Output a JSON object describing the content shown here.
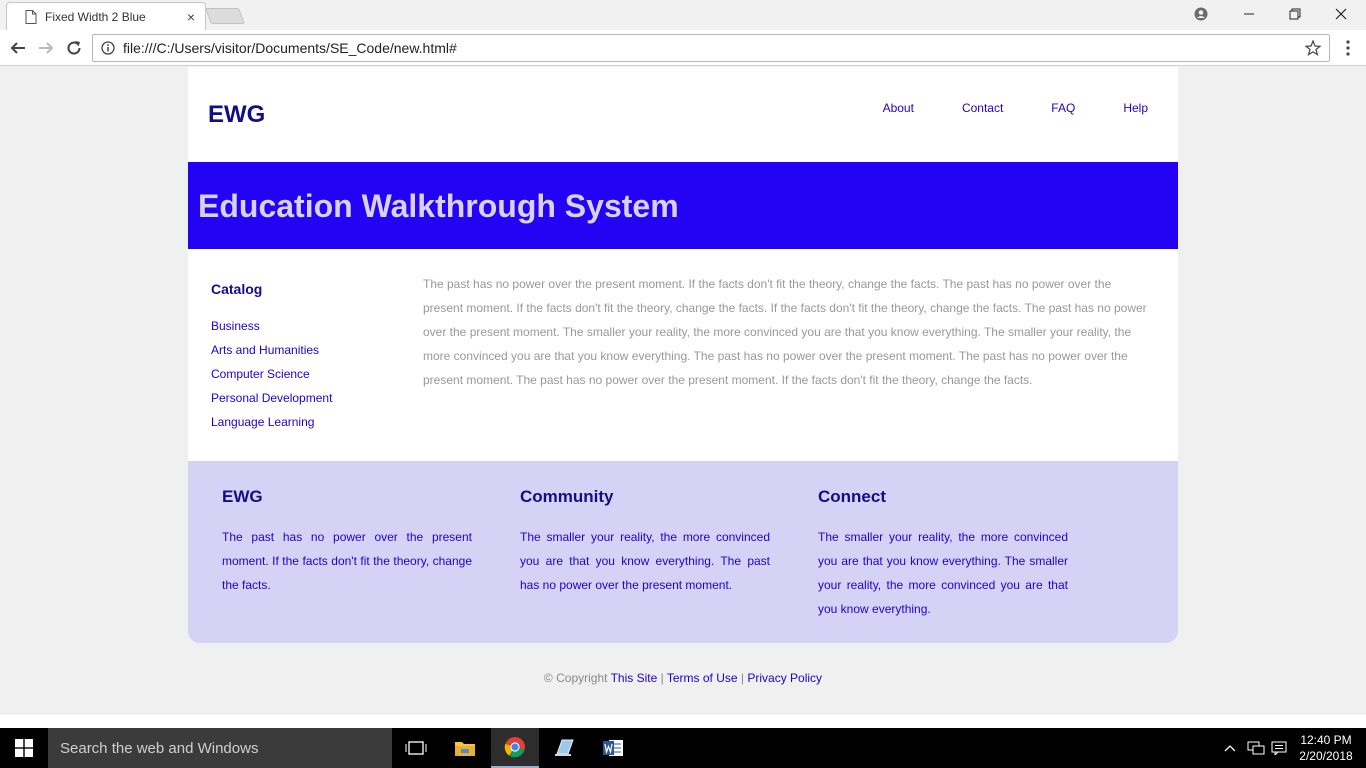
{
  "browser": {
    "tab_title": "Fixed Width 2 Blue",
    "tab_close": "×",
    "url": "file:///C:/Users/visitor/Documents/SE_Code/new.html#"
  },
  "page": {
    "logo": "EWG",
    "nav": [
      "About",
      "Contact",
      "FAQ",
      "Help"
    ],
    "banner_title": "Education Walkthrough System",
    "catalog": {
      "heading": "Catalog",
      "items": [
        "Business",
        "Arts and Humanities",
        "Computer Science",
        "Personal Development",
        "Language Learning"
      ]
    },
    "main_text": "The past has no power over the present moment. If the facts don't fit the theory, change the facts. The past has no power over the present moment. If the facts don't fit the theory, change the facts. If the facts don't fit the theory, change the facts. The past has no power over the present moment. The smaller your reality, the more convinced you are that you know everything. The smaller your reality, the more convinced you are that you know everything. The past has no power over the present moment. The past has no power over the present moment. The past has no power over the present moment. If the facts don't fit the theory, change the facts.",
    "footer_cols": [
      {
        "heading": "EWG",
        "text": "The past has no power over the present moment. If the facts don't fit the theory, change the facts."
      },
      {
        "heading": "Community",
        "text": "The smaller your reality, the more convinced you are that you know everything. The past has no power over the present moment."
      },
      {
        "heading": "Connect",
        "text": "The smaller your reality, the more convinced you are that you know everything. The smaller your reality, the more convinced you are that you know everything."
      }
    ],
    "copyright": {
      "prefix": "© Copyright",
      "this_site": "This Site",
      "sep": "|",
      "terms": "Terms of Use",
      "privacy": "Privacy Policy"
    }
  },
  "taskbar": {
    "search_placeholder": "Search the web and Windows",
    "time": "12:40 PM",
    "date": "2/20/2018"
  },
  "colors": {
    "brand_dark": "#130d88",
    "link": "#2200cc",
    "banner": "#2402f3",
    "footer_bg": "#d5d3f5"
  }
}
